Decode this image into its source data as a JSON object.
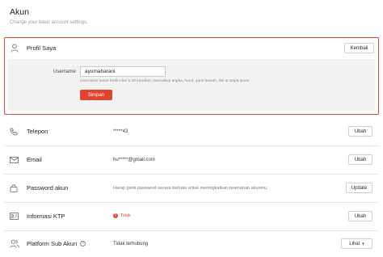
{
  "header": {
    "title": "Akun",
    "subtitle": "Change your basic account settings."
  },
  "profile": {
    "label": "Profil Saya",
    "back_button": "Kembali",
    "username_label": "Username",
    "username_value": "ayumaharani",
    "username_hint": "Username harus terdiri dari 5-30 karakter, mencakup angka, huruf, garis bawah, titik & tanpa spasi.",
    "save_button": "Simpan"
  },
  "rows": {
    "phone": {
      "label": "Telepon",
      "value": "*****43",
      "button": "Ubah"
    },
    "email": {
      "label": "Email",
      "value": "hu*****@gmail.com",
      "button": "Ubah"
    },
    "password": {
      "label": "Password akun",
      "description": "Harap ganti password secara berkala untuk meningkatkan keamanan akunmu.",
      "button": "Update"
    },
    "ktp": {
      "label": "Informasi KTP",
      "status": "Tolak",
      "button": "Ubah"
    },
    "sub_account": {
      "label": "Platform Sub Akun",
      "value": "Tidak terhubung",
      "button": "Lihat"
    }
  },
  "colors": {
    "accent": "#e0432f",
    "border_highlight": "#d94a36"
  },
  "icons": {
    "profile": "user-icon",
    "phone": "phone-icon",
    "email": "envelope-icon",
    "password": "lock-icon",
    "ktp": "id-card-icon",
    "sub_account": "users-icon"
  }
}
